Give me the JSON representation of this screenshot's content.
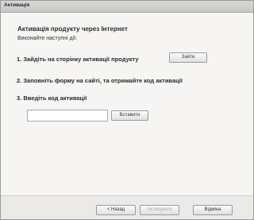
{
  "window": {
    "title": "Активація"
  },
  "main": {
    "heading": "Активація продукту через Інтернет",
    "subheading": "Виконайте наступні дії:",
    "step1": "1. Зайдіть на сторінку активації продукту",
    "go_button": "Зайти",
    "step2": "2. Заповніть форму на сайті, та отримайте код  активації",
    "step3": "3. Введіть код активації",
    "code_value": "",
    "paste_button": "Вставити"
  },
  "footer": {
    "back_button": "< Назад",
    "activate_button": "Активувати",
    "cancel_button": "Відміна"
  }
}
